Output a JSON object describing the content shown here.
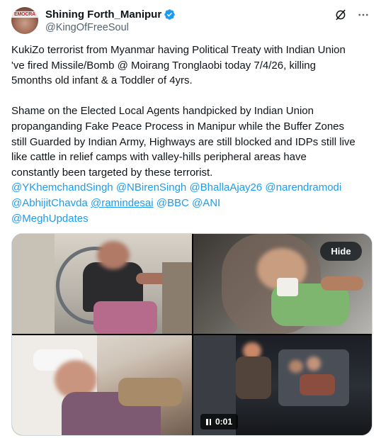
{
  "author": {
    "display_name": "Shining Forth_Manipur",
    "handle": "@KingOfFreeSoul",
    "avatar_text": "EMOCRA",
    "verified": true
  },
  "header_icons": [
    "grok-icon",
    "more-options-icon"
  ],
  "tweet": {
    "paragraph1_lines": [
      "KukiZo terrorist from Myanmar having Political Treaty with Indian Union",
      "'ve fired Missile/Bomb @ Moirang Tronglaobi today 7/4/26, killing",
      "5months old infant  & a Toddler of 4yrs."
    ],
    "paragraph2_lines": [
      "Shame on the Elected Local Agents handpicked by Indian Union",
      "propanganding Fake Peace Process in Manipur while the Buffer Zones",
      "still Guarded by Indian Army, Highways are still blocked and IDPs still live",
      "like cattle in relief camps with valley-hills peripheral areas have",
      "constantly been targeted by these terrorist."
    ],
    "mentions": {
      "m1": "@YKhemchandSingh",
      "m2": "@NBirenSingh",
      "m3": "@BhallaAjay26",
      "m4": "@narendramodi",
      "m5": "@AbhijitChavda",
      "m6": "@ramindesai",
      "m7": "@BBC",
      "m8": "@ANI",
      "m9": "@MeghUpdates"
    }
  },
  "media": {
    "hide_label": "Hide",
    "video_time": "0:01"
  },
  "colors": {
    "text": "#0f1419",
    "secondary": "#536471",
    "link": "#1d9bf0",
    "verified": "#1d9bf0",
    "border": "#cfd9de"
  }
}
